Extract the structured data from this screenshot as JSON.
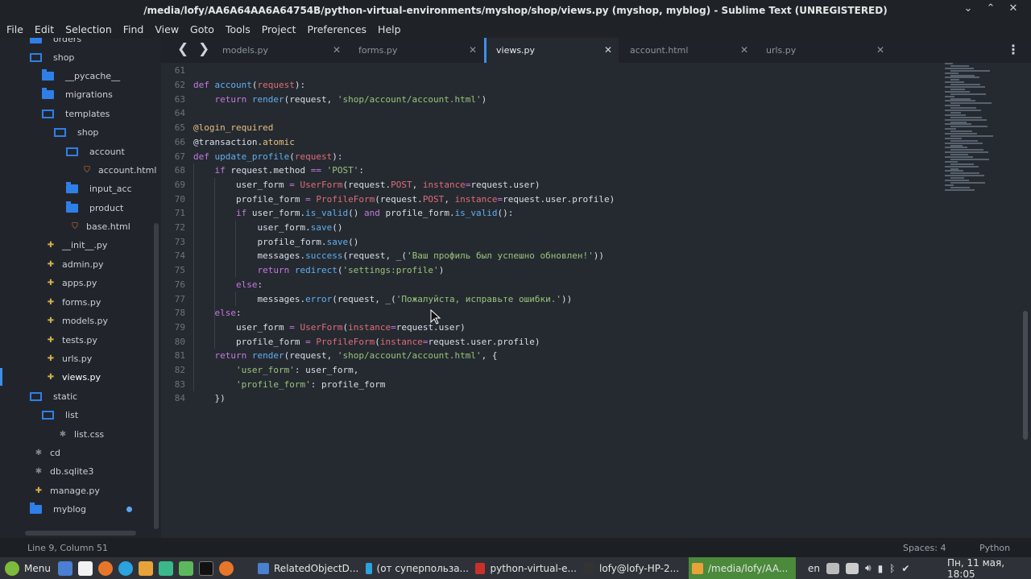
{
  "window": {
    "title": "/media/lofy/AA6A64AA6A64754B/python-virtual-environments/myshop/shop/views.py (myshop, myblog) - Sublime Text (UNREGISTERED)"
  },
  "menu": [
    "File",
    "Edit",
    "Selection",
    "Find",
    "View",
    "Goto",
    "Tools",
    "Project",
    "Preferences",
    "Help"
  ],
  "sidebar": {
    "items": [
      {
        "label": "orders",
        "type": "folder-closed"
      },
      {
        "label": "shop",
        "type": "folder-open"
      },
      {
        "label": "__pycache__",
        "type": "folder-closed"
      },
      {
        "label": "migrations",
        "type": "folder-closed"
      },
      {
        "label": "templates",
        "type": "folder-open"
      },
      {
        "label": "shop",
        "type": "folder-open"
      },
      {
        "label": "account",
        "type": "folder-open"
      },
      {
        "label": "account.html",
        "type": "html"
      },
      {
        "label": "input_acc",
        "type": "folder-closed"
      },
      {
        "label": "product",
        "type": "folder-closed"
      },
      {
        "label": "base.html",
        "type": "html"
      },
      {
        "label": "__init__.py",
        "type": "py"
      },
      {
        "label": "admin.py",
        "type": "py"
      },
      {
        "label": "apps.py",
        "type": "py"
      },
      {
        "label": "forms.py",
        "type": "py"
      },
      {
        "label": "models.py",
        "type": "py"
      },
      {
        "label": "tests.py",
        "type": "py"
      },
      {
        "label": "urls.py",
        "type": "py"
      },
      {
        "label": "views.py",
        "type": "py",
        "selected": true
      },
      {
        "label": "static",
        "type": "folder-open"
      },
      {
        "label": "list",
        "type": "folder-open"
      },
      {
        "label": "list.css",
        "type": "star"
      },
      {
        "label": "cd",
        "type": "star"
      },
      {
        "label": "db.sqlite3",
        "type": "star"
      },
      {
        "label": "manage.py",
        "type": "py"
      },
      {
        "label": "myblog",
        "type": "folder-closed"
      }
    ]
  },
  "tabs": [
    {
      "label": "models.py"
    },
    {
      "label": "forms.py"
    },
    {
      "label": "views.py",
      "active": true
    },
    {
      "label": "account.html"
    },
    {
      "label": "urls.py"
    }
  ],
  "editor": {
    "lines": [
      {
        "n": "61",
        "indent": 0,
        "tokens": []
      },
      {
        "n": "62",
        "indent": 0,
        "tokens": [
          [
            "kw",
            "def "
          ],
          [
            "fn",
            "account"
          ],
          [
            "code",
            "("
          ],
          [
            "param",
            "request"
          ],
          [
            "code",
            "):"
          ]
        ]
      },
      {
        "n": "63",
        "indent": 1,
        "tokens": [
          [
            "kw",
            "return "
          ],
          [
            "fn",
            "render"
          ],
          [
            "code",
            "(request, "
          ],
          [
            "str",
            "'shop/account/account.html'"
          ],
          [
            "code",
            ")"
          ]
        ]
      },
      {
        "n": "64",
        "indent": 0,
        "tokens": []
      },
      {
        "n": "65",
        "indent": 0,
        "tokens": [
          [
            "dec",
            "@login_required"
          ]
        ]
      },
      {
        "n": "66",
        "indent": 0,
        "tokens": [
          [
            "code",
            "@transaction."
          ],
          [
            "dec",
            "atomic"
          ]
        ]
      },
      {
        "n": "67",
        "indent": 0,
        "tokens": [
          [
            "kw",
            "def "
          ],
          [
            "fn",
            "update_profile"
          ],
          [
            "code",
            "("
          ],
          [
            "param",
            "request"
          ],
          [
            "code",
            "):"
          ]
        ]
      },
      {
        "n": "68",
        "indent": 1,
        "tokens": [
          [
            "kw",
            "if "
          ],
          [
            "code",
            "request.method "
          ],
          [
            "kw",
            "== "
          ],
          [
            "str",
            "'POST'"
          ],
          [
            "code",
            ":"
          ]
        ]
      },
      {
        "n": "69",
        "indent": 2,
        "tokens": [
          [
            "code",
            "user_form "
          ],
          [
            "kw",
            "= "
          ],
          [
            "cls",
            "UserForm"
          ],
          [
            "code",
            "(request."
          ],
          [
            "cls",
            "POST"
          ],
          [
            "code",
            ", "
          ],
          [
            "param",
            "instance"
          ],
          [
            "kw",
            "="
          ],
          [
            "code",
            "request.user)"
          ]
        ]
      },
      {
        "n": "70",
        "indent": 2,
        "tokens": [
          [
            "code",
            "profile_form "
          ],
          [
            "kw",
            "= "
          ],
          [
            "cls",
            "ProfileForm"
          ],
          [
            "code",
            "(request."
          ],
          [
            "cls",
            "POST"
          ],
          [
            "code",
            ", "
          ],
          [
            "param",
            "instance"
          ],
          [
            "kw",
            "="
          ],
          [
            "code",
            "request.user.profile)"
          ]
        ]
      },
      {
        "n": "71",
        "indent": 2,
        "tokens": [
          [
            "kw",
            "if "
          ],
          [
            "code",
            "user_form."
          ],
          [
            "fn",
            "is_valid"
          ],
          [
            "code",
            "() "
          ],
          [
            "kw",
            "and "
          ],
          [
            "code",
            "profile_form."
          ],
          [
            "fn",
            "is_valid"
          ],
          [
            "code",
            "():"
          ]
        ]
      },
      {
        "n": "72",
        "indent": 3,
        "tokens": [
          [
            "code",
            "user_form."
          ],
          [
            "fn",
            "save"
          ],
          [
            "code",
            "()"
          ]
        ]
      },
      {
        "n": "73",
        "indent": 3,
        "tokens": [
          [
            "code",
            "profile_form."
          ],
          [
            "fn",
            "save"
          ],
          [
            "code",
            "()"
          ]
        ]
      },
      {
        "n": "74",
        "indent": 3,
        "tokens": [
          [
            "code",
            "messages."
          ],
          [
            "fn",
            "success"
          ],
          [
            "code",
            "(request, _("
          ],
          [
            "str",
            "'Ваш профиль был успешно обновлен!'"
          ],
          [
            "code",
            "))"
          ]
        ]
      },
      {
        "n": "75",
        "indent": 3,
        "tokens": [
          [
            "kw",
            "return "
          ],
          [
            "fn",
            "redirect"
          ],
          [
            "code",
            "("
          ],
          [
            "str",
            "'settings:profile'"
          ],
          [
            "code",
            ")"
          ]
        ]
      },
      {
        "n": "76",
        "indent": 2,
        "tokens": [
          [
            "kw",
            "else"
          ],
          [
            "code",
            ":"
          ]
        ]
      },
      {
        "n": "77",
        "indent": 3,
        "tokens": [
          [
            "code",
            "messages."
          ],
          [
            "fn",
            "error"
          ],
          [
            "code",
            "(request, _("
          ],
          [
            "str",
            "'Пожалуйста, исправьте ошибки.'"
          ],
          [
            "code",
            "))"
          ]
        ]
      },
      {
        "n": "78",
        "indent": 1,
        "tokens": [
          [
            "kw",
            "else"
          ],
          [
            "code",
            ":"
          ]
        ]
      },
      {
        "n": "79",
        "indent": 2,
        "tokens": [
          [
            "code",
            "user_form "
          ],
          [
            "kw",
            "= "
          ],
          [
            "cls",
            "UserForm"
          ],
          [
            "code",
            "("
          ],
          [
            "param",
            "instance"
          ],
          [
            "kw",
            "="
          ],
          [
            "code",
            "request.user)"
          ]
        ]
      },
      {
        "n": "80",
        "indent": 2,
        "tokens": [
          [
            "code",
            "profile_form "
          ],
          [
            "kw",
            "= "
          ],
          [
            "cls",
            "ProfileForm"
          ],
          [
            "code",
            "("
          ],
          [
            "param",
            "instance"
          ],
          [
            "kw",
            "="
          ],
          [
            "code",
            "request.user.profile)"
          ]
        ]
      },
      {
        "n": "81",
        "indent": 1,
        "tokens": [
          [
            "kw",
            "return "
          ],
          [
            "fn",
            "render"
          ],
          [
            "code",
            "(request, "
          ],
          [
            "str",
            "'shop/account/account.html'"
          ],
          [
            "code",
            ", {"
          ]
        ]
      },
      {
        "n": "82",
        "indent": 2,
        "tokens": [
          [
            "str",
            "'user_form'"
          ],
          [
            "code",
            ": user_form,"
          ]
        ]
      },
      {
        "n": "83",
        "indent": 2,
        "tokens": [
          [
            "str",
            "'profile_form'"
          ],
          [
            "code",
            ": profile_form"
          ]
        ]
      },
      {
        "n": "84",
        "indent": 1,
        "tokens": [
          [
            "code",
            "})"
          ]
        ]
      }
    ]
  },
  "status": {
    "position": "Line 9, Column 51",
    "spaces": "Spaces: 4",
    "syntax": "Python"
  },
  "taskbar": {
    "menu_label": "Menu",
    "tasks": [
      {
        "label": "RelatedObjectD...",
        "color": "#4a7fd1"
      },
      {
        "label": "(от суперпольза...",
        "color": "#2aa3e0"
      },
      {
        "label": "python-virtual-e...",
        "color": "#c9302c"
      },
      {
        "label": "lofy@lofy-HP-2...",
        "color": "#333333"
      },
      {
        "label": "/media/lofy/AA...",
        "color": "#e8a23a",
        "active": true
      }
    ],
    "lang": "en",
    "clock": "Пн, 11 мая, 18:05"
  },
  "colors": {
    "accent": "#3d8fe8",
    "folder": "#2f7fe8",
    "taskbar_active": "#4a8a3a"
  }
}
